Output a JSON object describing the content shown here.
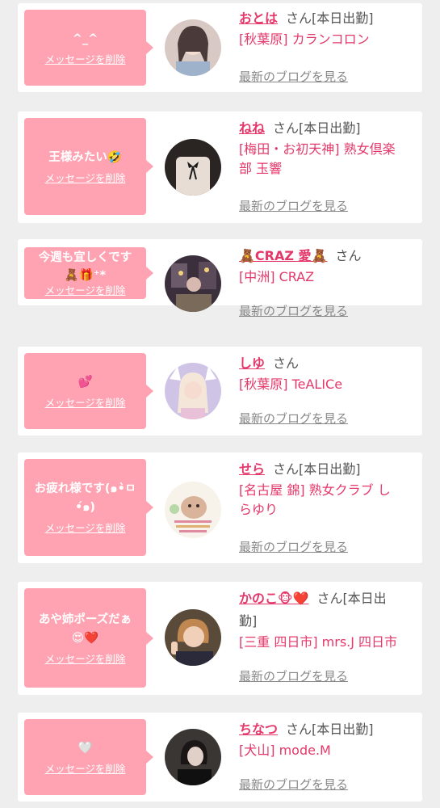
{
  "cards": [
    {
      "message": "^_^",
      "delete_label": "メッセージを削除",
      "name": "おとは",
      "suffix": "さん[本日出勤]",
      "shop_lines": [
        "[秋葉原] カランコロン"
      ],
      "blog_label": "最新のブログを見る"
    },
    {
      "message": "王様みたい🤣",
      "delete_label": "メッセージを削除",
      "name": "ねね",
      "suffix": "さん[本日出勤]",
      "shop_lines": [
        "[梅田・お初天神] 熟女倶楽",
        "部 玉響"
      ],
      "blog_label": "最新のブログを見る"
    },
    {
      "message_lines": [
        "今週も宜しくです",
        "🧸🎁⁺*"
      ],
      "delete_label": "メッセージを削除",
      "name": "🧸CRAZ 愛🧸",
      "suffix": "さん",
      "shop_lines": [
        "[中洲] CRAZ"
      ],
      "blog_label": "最新のブログを見る"
    },
    {
      "message": "💕",
      "delete_label": "メッセージを削除",
      "name": "しゆ",
      "suffix": "さん",
      "shop_lines": [
        "[秋葉原] TeALICe"
      ],
      "blog_label": "最新のブログを見る"
    },
    {
      "message_lines": [
        "お疲れ様です(๑•̀ㅁ",
        "•́๑)"
      ],
      "delete_label": "メッセージを削除",
      "name": "せら",
      "suffix": "さん[本日出勤]",
      "shop_lines": [
        "[名古屋 錦] 熟女クラブ し",
        "らゆり"
      ],
      "blog_label": "最新のブログを見る"
    },
    {
      "message_lines": [
        "あや姉ポーズだぁ",
        "😍❤️"
      ],
      "delete_label": "メッセージを削除",
      "name": "かのこ🐵❤️",
      "suffix_lines": [
        "さん[本日出",
        "勤]"
      ],
      "shop_lines": [
        "[三重 四日市] mrs.J 四日市"
      ],
      "blog_label": "最新のブログを見る"
    },
    {
      "message": "🤍",
      "delete_label": "メッセージを削除",
      "name": "ちなつ",
      "suffix": "さん[本日出勤]",
      "shop_lines": [
        "[犬山] mode.M"
      ],
      "blog_label": "最新のブログを見る"
    }
  ],
  "colors": {
    "bubble": "#ffa3b3",
    "name": "#e4386a",
    "background": "#eeeeee"
  },
  "icons": {
    "avatar": "profile-photo"
  }
}
